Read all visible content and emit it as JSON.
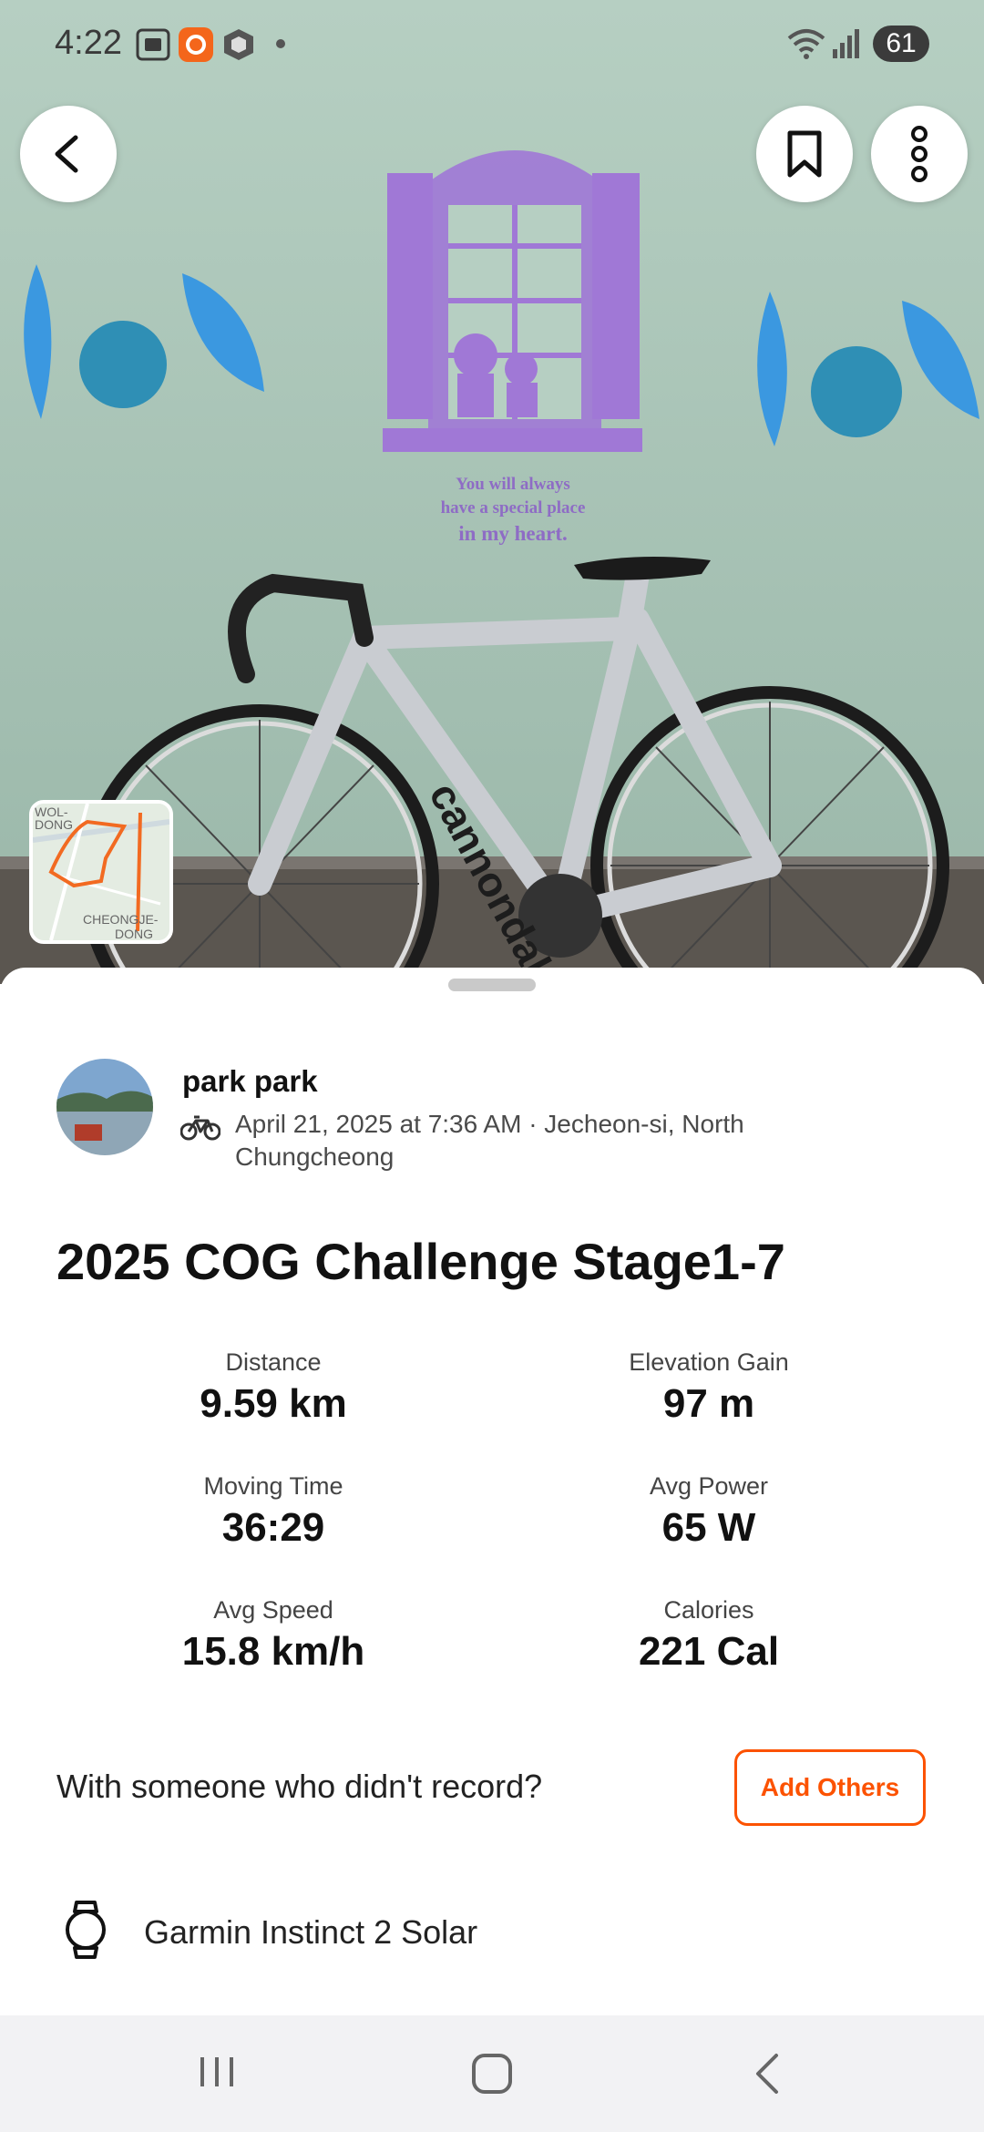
{
  "status_bar": {
    "time": "4:22",
    "battery": "61",
    "icons": [
      "screenshot-icon",
      "app-notification-icon",
      "package-icon",
      "dot-icon",
      "wifi-icon",
      "signal-icon"
    ]
  },
  "hero": {
    "wall_text_line1": "You will always",
    "wall_text_line2": "have a special place",
    "wall_text_line3": "in my heart.",
    "bike_brand": "cannondale",
    "map_label_top": "WOL-\nDONG",
    "map_label_bottom": "CHEONGJE-\nDONG"
  },
  "activity": {
    "athlete_name": "park park",
    "datetime_location": "April 21, 2025 at 7:36 AM · Jecheon-si, North Chungcheong",
    "title": "2025 COG Challenge Stage1-7",
    "sport_icon": "bike-icon"
  },
  "stats": [
    {
      "label": "Distance",
      "value": "9.59 km"
    },
    {
      "label": "Elevation Gain",
      "value": "97 m"
    },
    {
      "label": "Moving Time",
      "value": "36:29"
    },
    {
      "label": "Avg Power",
      "value": "65 W"
    },
    {
      "label": "Avg Speed",
      "value": "15.8 km/h"
    },
    {
      "label": "Calories",
      "value": "221 Cal"
    }
  ],
  "add_others": {
    "prompt": "With someone who didn't record?",
    "button_label": "Add Others"
  },
  "device": {
    "name": "Garmin Instinct 2 Solar",
    "icon": "watch-icon"
  },
  "colors": {
    "accent": "#fc5200",
    "wall": "#a9c4b6",
    "window_purple": "#a078d6"
  }
}
